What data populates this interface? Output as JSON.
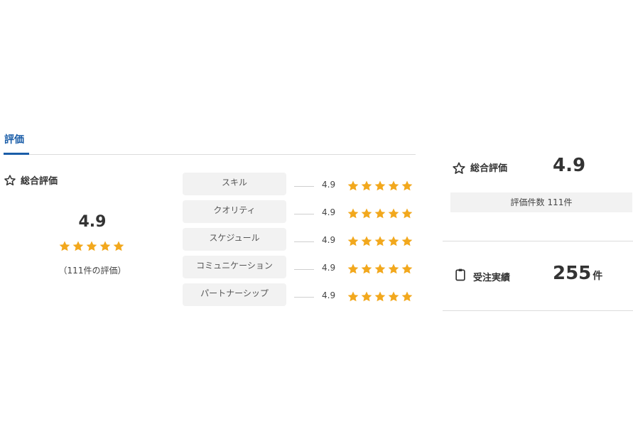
{
  "tab": {
    "label": "評価"
  },
  "overall": {
    "heading": "総合評価",
    "score": "4.9",
    "stars_filled": 5,
    "stars_total": 5,
    "count_text": "（111件の評価）"
  },
  "categories": [
    {
      "label": "スキル",
      "score": "4.9"
    },
    {
      "label": "クオリティ",
      "score": "4.9"
    },
    {
      "label": "スケジュール",
      "score": "4.9"
    },
    {
      "label": "コミュニケーション",
      "score": "4.9"
    },
    {
      "label": "パートナーシップ",
      "score": "4.9"
    }
  ],
  "summary": {
    "rating_heading": "総合評価",
    "rating_score": "4.9",
    "rating_count_label": "評価件数",
    "rating_count_value": "111件",
    "orders_heading": "受注実績",
    "orders_value": "255",
    "orders_unit": "件"
  },
  "colors": {
    "accent": "#1a5da8",
    "star": "#f2a81d",
    "chip_bg": "#f2f2f2"
  },
  "icons": {
    "overall": "star-outline-icon",
    "orders": "clipboard-icon"
  }
}
